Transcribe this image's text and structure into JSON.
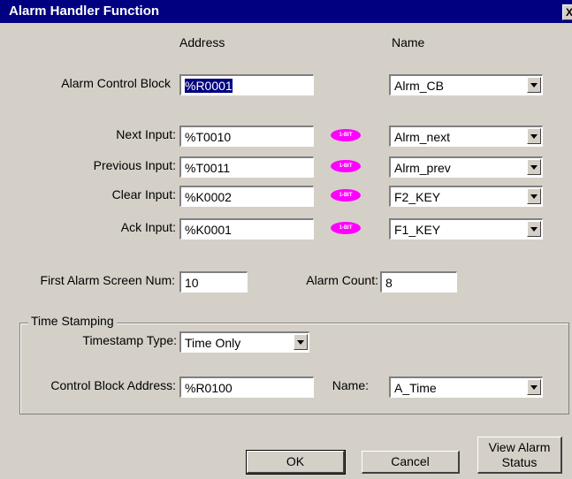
{
  "window": {
    "title": "Alarm Handler Function",
    "close_label": "X"
  },
  "headers": {
    "address": "Address",
    "name": "Name"
  },
  "alarm_control_block": {
    "label": "Alarm Control Block",
    "address": "%R0001",
    "name": "Alrm_CB"
  },
  "inputs": [
    {
      "label": "Next Input:",
      "address": "%T0010",
      "badge": "1-BIT",
      "name": "Alrm_next"
    },
    {
      "label": "Previous Input:",
      "address": "%T0011",
      "badge": "1-BIT",
      "name": "Alrm_prev"
    },
    {
      "label": "Clear Input:",
      "address": "%K0002",
      "badge": "1-BIT",
      "name": "F2_KEY"
    },
    {
      "label": "Ack Input:",
      "address": "%K0001",
      "badge": "1-BIT",
      "name": "F1_KEY"
    }
  ],
  "first_alarm": {
    "label": "First Alarm Screen Num:",
    "value": "10"
  },
  "alarm_count": {
    "label": "Alarm Count:",
    "value": "8"
  },
  "time_stamping": {
    "group_label": "Time Stamping",
    "type_label": "Timestamp Type:",
    "type_value": "Time Only",
    "cb_label": "Control Block Address:",
    "cb_address": "%R0100",
    "name_label": "Name:",
    "name_value": "A_Time"
  },
  "buttons": {
    "ok": "OK",
    "cancel": "Cancel",
    "view_line1": "View Alarm",
    "view_line2": "Status"
  },
  "colors": {
    "titlebar": "#000080",
    "badge": "#ff00ff",
    "dialog": "#d4d0c8"
  }
}
